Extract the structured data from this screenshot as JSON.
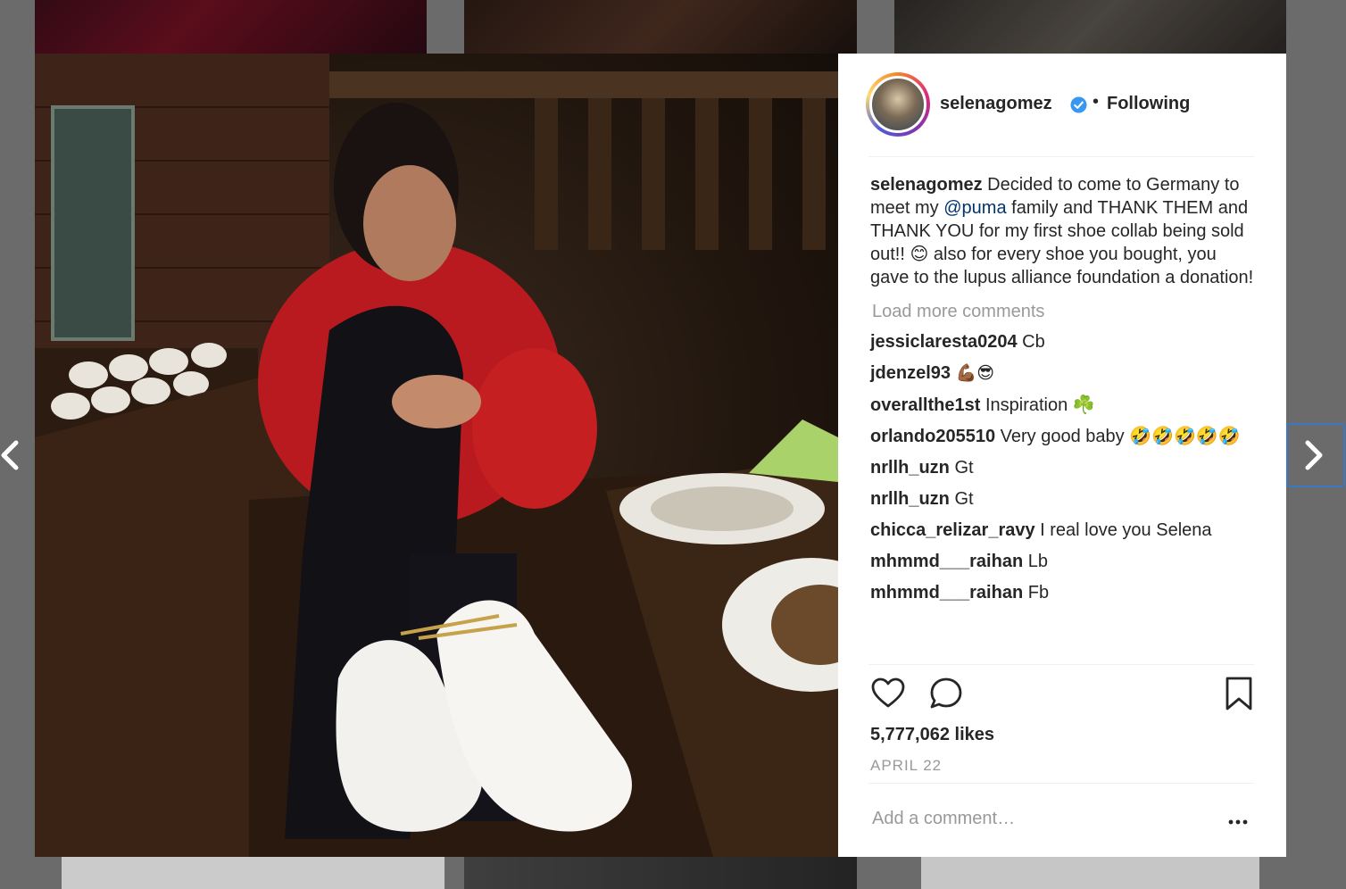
{
  "post": {
    "username": "selenagomez",
    "separator": "•",
    "following_label": "Following",
    "caption": {
      "author": "selenagomez",
      "text_before": "Decided to come to Germany to meet my",
      "mention": "@puma",
      "text_after": "family and THANK THEM and THANK YOU for my first shoe collab being sold out!! 😊 also for every shoe you bought, you gave to the lupus alliance foundation a donation!"
    },
    "load_more_label": "Load more comments",
    "comments": [
      {
        "user": "jessiclaresta0204",
        "text": "Cb"
      },
      {
        "user": "jdenzel93",
        "text": "💪🏾😎"
      },
      {
        "user": "overallthe1st",
        "text": "Inspiration ☘️"
      },
      {
        "user": "orlando205510",
        "text": "Very good baby 🤣🤣🤣🤣🤣"
      },
      {
        "user": "nrllh_uzn",
        "text": "Gt"
      },
      {
        "user": "nrllh_uzn",
        "text": "Gt"
      },
      {
        "user": "chicca_relizar_ravy",
        "text": "I real love you Selena"
      },
      {
        "user": "mhmmd___raihan",
        "text": "Lb"
      },
      {
        "user": "mhmmd___raihan",
        "text": "Fb"
      }
    ],
    "likes": "5,777,062 likes",
    "date": "APRIL 22",
    "add_comment_placeholder": "Add a comment…"
  },
  "icons": {
    "like": "heart-icon",
    "comment": "comment-bubble-icon",
    "save": "bookmark-icon",
    "more": "more-options-icon",
    "verified": "verified-badge-icon",
    "prev": "chevron-left-icon",
    "next": "chevron-right-icon"
  },
  "colors": {
    "text": "#262626",
    "muted": "#999999",
    "mention": "#003569",
    "verified": "#3897f0",
    "focus_outline": "#3b78c4"
  }
}
